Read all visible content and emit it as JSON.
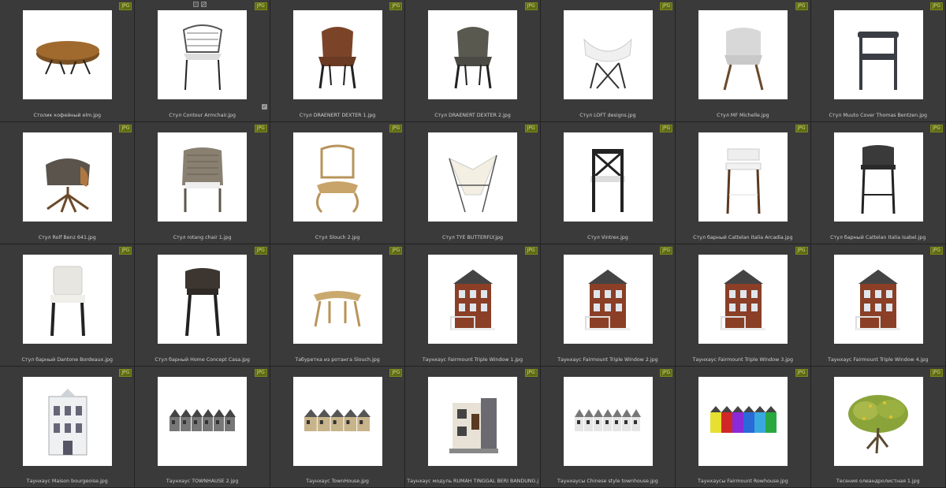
{
  "badge_text": "JPG",
  "check_glyph": "✓",
  "items": [
    {
      "name": "Столик кофейный elm.jpg",
      "icon": "coffee-table"
    },
    {
      "name": "Стул Contour Armchair.jpg",
      "icon": "wire-chair"
    },
    {
      "name": "Стул DRAENERT DEXTER 1.jpg",
      "icon": "leather-chair-brown"
    },
    {
      "name": "Стул DRAENERT DEXTER 2.jpg",
      "icon": "leather-chair-grey"
    },
    {
      "name": "Стул LOFT designs.jpg",
      "icon": "eames-chair"
    },
    {
      "name": "Стул MF Michelle.jpg",
      "icon": "fabric-chair"
    },
    {
      "name": "Стул Muuto Cover Thomas Bentzen.jpg",
      "icon": "dark-armchair"
    },
    {
      "name": "Стул Rolf Benz 641.jpg",
      "icon": "swivel-chair"
    },
    {
      "name": "Стул rotang chair 1.jpg",
      "icon": "rattan-armchair"
    },
    {
      "name": "Стул Slouch 2.jpg",
      "icon": "rattan-lounge"
    },
    {
      "name": "Стул TYE BUTTERFLY.jpg",
      "icon": "butterfly-chair"
    },
    {
      "name": "Стул Vintrex.jpg",
      "icon": "cross-back-chair"
    },
    {
      "name": "Стул барный Cattelan Italia Arcadia.jpg",
      "icon": "bar-stool-white"
    },
    {
      "name": "Стул барный Cattelan Italia Isabel.jpg",
      "icon": "bar-stool-dark"
    },
    {
      "name": "Стул барный Dantone Bordeaux.jpg",
      "icon": "tufted-bar-stool"
    },
    {
      "name": "Стул барный Home Concept Casa.jpg",
      "icon": "high-bar-stool"
    },
    {
      "name": "Табуретка из ротанга Slouch.jpg",
      "icon": "rattan-stool"
    },
    {
      "name": "Таунхаус Fairmount Triple Window 1.jpg",
      "icon": "brick-house"
    },
    {
      "name": "Таунхаус Fairmount Triple Window 2.jpg",
      "icon": "brick-house"
    },
    {
      "name": "Таунхаус Fairmount Triple Window 3.jpg",
      "icon": "brick-house"
    },
    {
      "name": "Таунхаус Fairmount Triple Window 4.jpg",
      "icon": "brick-house"
    },
    {
      "name": "Таунхаус Maison bourgeoise.jpg",
      "icon": "maison"
    },
    {
      "name": "Таунхаус TOWNHAUSE 2.jpg",
      "icon": "townhouse-row-grey"
    },
    {
      "name": "Таунхаус TownHouse.jpg",
      "icon": "townhouse-row-tan"
    },
    {
      "name": "Таунхаус модуль RUMAH TINGGAL BERI BANDUNG.jpg",
      "icon": "modern-house"
    },
    {
      "name": "Таунхаусы Chinese style townhouse.jpg",
      "icon": "townhouse-row-white"
    },
    {
      "name": "Таунхаусы Fairmount Rowhouse.jpg",
      "icon": "colorful-rowhouses"
    },
    {
      "name": "Тесения олеандролистная 1.jpg",
      "icon": "tree"
    }
  ]
}
